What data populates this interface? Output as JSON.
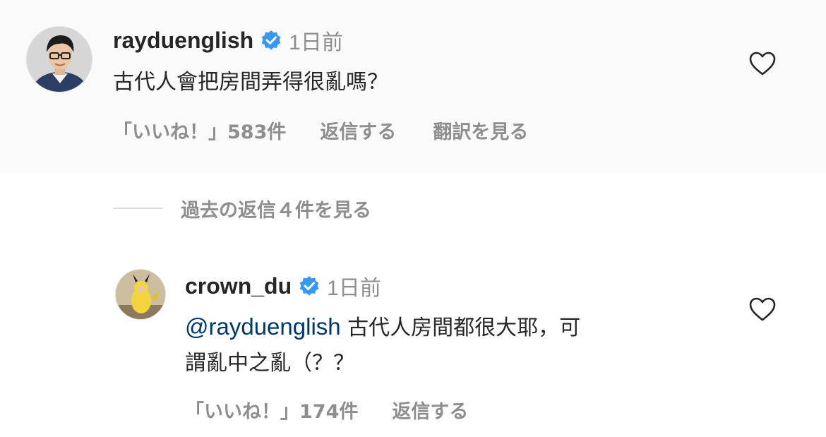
{
  "comment": {
    "username": "rayduenglish",
    "time": "1日前",
    "text": "古代人會把房間弄得很亂嗎？",
    "likes": "「いいね！」583件",
    "reply_label": "返信する",
    "translate_label": "翻訳を見る",
    "verified_icon": "verified-badge-icon",
    "like_icon": "heart-icon"
  },
  "view_replies": {
    "label": "過去の返信４件を見る"
  },
  "reply": {
    "username": "crown_du",
    "time": "1日前",
    "mention": "@rayduenglish",
    "text_line1": " 古代人房間都很大耶，可",
    "text_line2": "謂亂中之亂（？？",
    "likes": "「いいね！」174件",
    "reply_label": "返信する",
    "verified_icon": "verified-badge-icon",
    "like_icon": "heart-icon"
  },
  "colors": {
    "accent_blue": "#3897f0",
    "mention_blue": "#00376b",
    "secondary_gray": "#8e8e8e",
    "text_dark": "#262626"
  }
}
